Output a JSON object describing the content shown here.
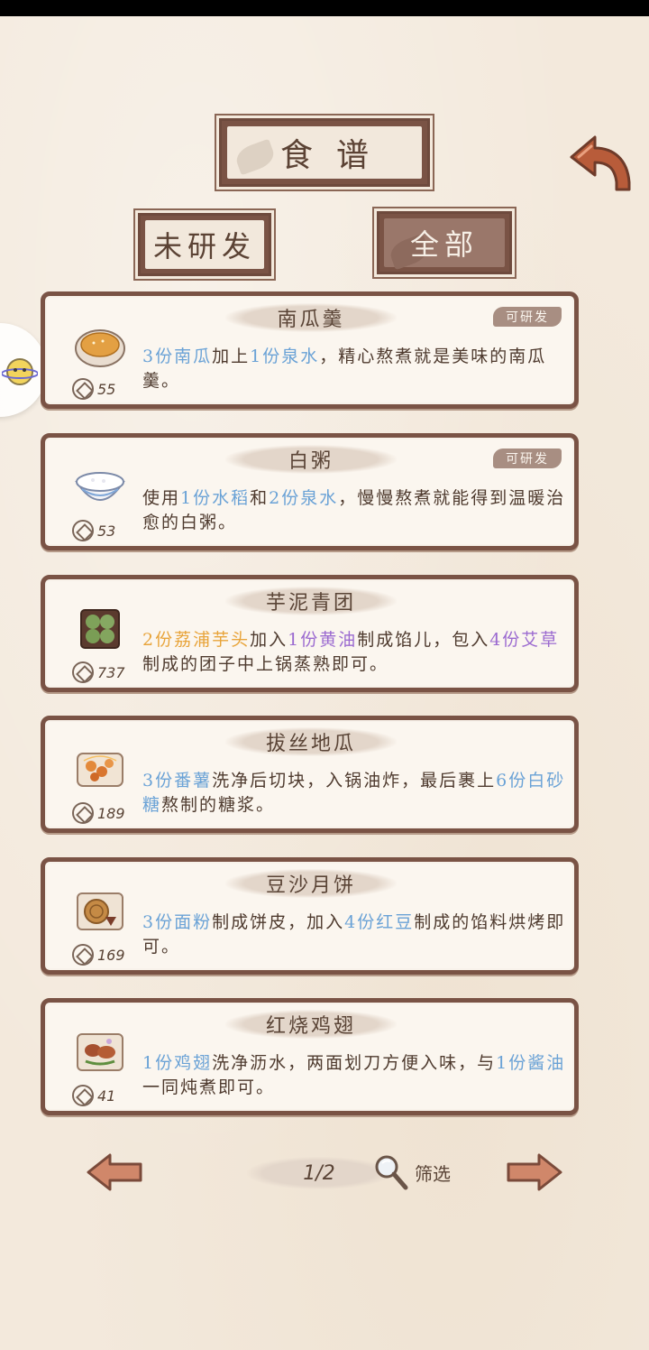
{
  "header": {
    "title": "食谱",
    "filters": {
      "undeveloped_label": "未研发",
      "all_label": "全部",
      "active": "全部"
    }
  },
  "recipes": [
    {
      "name": "南瓜羹",
      "badge": "可研发",
      "cost": "55",
      "icon": "pumpkin-soup-icon",
      "desc_parts": [
        {
          "text": "3份南瓜",
          "color": "blue"
        },
        {
          "text": "加上",
          "color": "normal"
        },
        {
          "text": "1份泉水",
          "color": "blue"
        },
        {
          "text": "，精心熬煮就是美味的南瓜羹。",
          "color": "normal"
        }
      ]
    },
    {
      "name": "白粥",
      "badge": "可研发",
      "cost": "53",
      "icon": "rice-porridge-icon",
      "desc_parts": [
        {
          "text": "使用",
          "color": "normal"
        },
        {
          "text": "1份水稻",
          "color": "blue"
        },
        {
          "text": "和",
          "color": "normal"
        },
        {
          "text": "2份泉水",
          "color": "blue"
        },
        {
          "text": "，慢慢熬煮就能得到温暖治愈的白粥。",
          "color": "normal"
        }
      ]
    },
    {
      "name": "芋泥青团",
      "badge": "",
      "cost": "737",
      "icon": "green-rice-ball-icon",
      "desc_parts": [
        {
          "text": "2份荔浦芋头",
          "color": "orange"
        },
        {
          "text": "加入",
          "color": "normal"
        },
        {
          "text": "1份黄油",
          "color": "purple"
        },
        {
          "text": "制成馅儿，包入",
          "color": "normal"
        },
        {
          "text": "4份艾草",
          "color": "purple"
        },
        {
          "text": "制成的团子中上锅蒸熟即可。",
          "color": "normal"
        }
      ]
    },
    {
      "name": "拔丝地瓜",
      "badge": "",
      "cost": "189",
      "icon": "candied-sweet-potato-icon",
      "desc_parts": [
        {
          "text": "3份番薯",
          "color": "blue"
        },
        {
          "text": "洗净后切块，入锅油炸，最后裹上",
          "color": "normal"
        },
        {
          "text": "6份白砂糖",
          "color": "blue"
        },
        {
          "text": "熬制的糖浆。",
          "color": "normal"
        }
      ]
    },
    {
      "name": "豆沙月饼",
      "badge": "",
      "cost": "169",
      "icon": "mooncake-icon",
      "desc_parts": [
        {
          "text": "3份面粉",
          "color": "blue"
        },
        {
          "text": "制成饼皮，加入",
          "color": "normal"
        },
        {
          "text": "4份红豆",
          "color": "blue"
        },
        {
          "text": "制成的馅料烘烤即可。",
          "color": "normal"
        }
      ]
    },
    {
      "name": "红烧鸡翅",
      "badge": "",
      "cost": "41",
      "icon": "braised-chicken-wings-icon",
      "desc_parts": [
        {
          "text": "1份鸡翅",
          "color": "blue"
        },
        {
          "text": "洗净沥水，两面划刀方便入味，与",
          "color": "normal"
        },
        {
          "text": "1份酱油",
          "color": "blue"
        },
        {
          "text": "一同炖煮即可。",
          "color": "normal"
        }
      ]
    }
  ],
  "pagination": {
    "page": "1/2",
    "filter_label": "筛选"
  },
  "colors": {
    "frame_brown": "#7a5345",
    "paper": "#f3e9dc",
    "highlight_blue": "#6aa2d6",
    "highlight_orange": "#e8a43a",
    "highlight_purple": "#9b6ad0"
  }
}
